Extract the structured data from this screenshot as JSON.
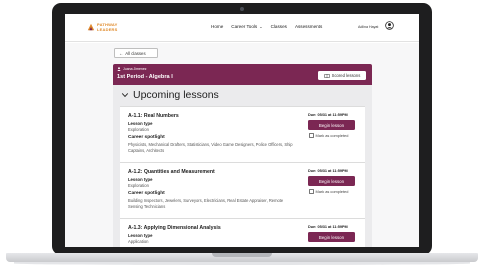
{
  "brand": {
    "logo_line1": "PATHWAY",
    "logo_line2": "LEADERS",
    "accent_color": "#e08a2a",
    "primary_color": "#7b2753"
  },
  "nav": {
    "items": [
      {
        "label": "Home"
      },
      {
        "label": "Career Tools",
        "has_dropdown": true
      },
      {
        "label": "Classes"
      },
      {
        "label": "Assessments"
      }
    ],
    "user_name": "Adlina Hayat",
    "user_icon": "account-circle-icon"
  },
  "back_button": {
    "arrow": "←",
    "label": "All classes"
  },
  "class_header": {
    "teacher_icon": "person-icon",
    "teacher_name": "Juana Jimenez",
    "class_title": "1st Period - Algebra I",
    "scored_icon": "scoreboard-icon",
    "scored_label": "Scored lessons"
  },
  "section": {
    "title": "Upcoming lessons",
    "collapse_icon": "chevron-down-icon"
  },
  "lessons": [
    {
      "title": "A-1.1: Real Numbers",
      "type_label": "Lesson type",
      "type": "Exploration",
      "spotlight_label": "Career spotlight",
      "spotlight": "Physicists, Mechanical Drafters, Statisticians, Video Game Designers, Police Officers, Ship Captains, Architects",
      "due": "Due: 05/31 at 11:59PM",
      "begin_label": "Begin lesson",
      "mark_label": "Mark as completed"
    },
    {
      "title": "A-1.2: Quantities and Measurement",
      "type_label": "Lesson type",
      "type": "Exploration",
      "spotlight_label": "Career spotlight",
      "spotlight": "Building Inspectors, Jewelers, Surveyors, Electricians, Real Estate Appraiser, Remote Sensing Technicians",
      "due": "Due: 05/31 at 11:59PM",
      "begin_label": "Begin lesson",
      "mark_label": "Mark as completed"
    },
    {
      "title": "A-1.3: Applying Dimensional Analysis",
      "type_label": "Lesson type",
      "type": "Application",
      "due": "Due: 05/31 at 11:59PM",
      "begin_label": "Begin lesson"
    }
  ]
}
